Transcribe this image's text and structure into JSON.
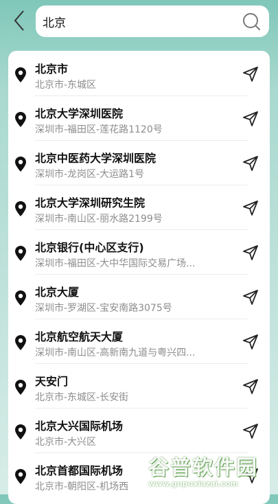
{
  "search": {
    "query": "北京"
  },
  "results": [
    {
      "name": "北京市",
      "address": "北京市-东城区"
    },
    {
      "name": "北京大学深圳医院",
      "address": "深圳市-福田区-莲花路1120号"
    },
    {
      "name": "北京中医药大学深圳医院",
      "address": "深圳市-龙岗区-大运路1号"
    },
    {
      "name": "北京大学深圳研究生院",
      "address": "深圳市-南山区-丽水路2199号"
    },
    {
      "name": "北京银行(中心区支行)",
      "address": "深圳市-福田区-大中华国际交易广场..."
    },
    {
      "name": "北京大厦",
      "address": "深圳市-罗湖区-宝安南路3075号"
    },
    {
      "name": "北京航空航天大厦",
      "address": "深圳市-南山区-高新南九道与粤兴四..."
    },
    {
      "name": "天安门",
      "address": "北京市-东城区-长安街"
    },
    {
      "name": "北京大兴国际机场",
      "address": "北京市-大兴区"
    },
    {
      "name": "北京首都国际机场",
      "address": "北京市-朝阳区-机场西"
    }
  ],
  "watermark": {
    "title": "谷普软件园",
    "url": "www.gupuxiazai.com"
  }
}
